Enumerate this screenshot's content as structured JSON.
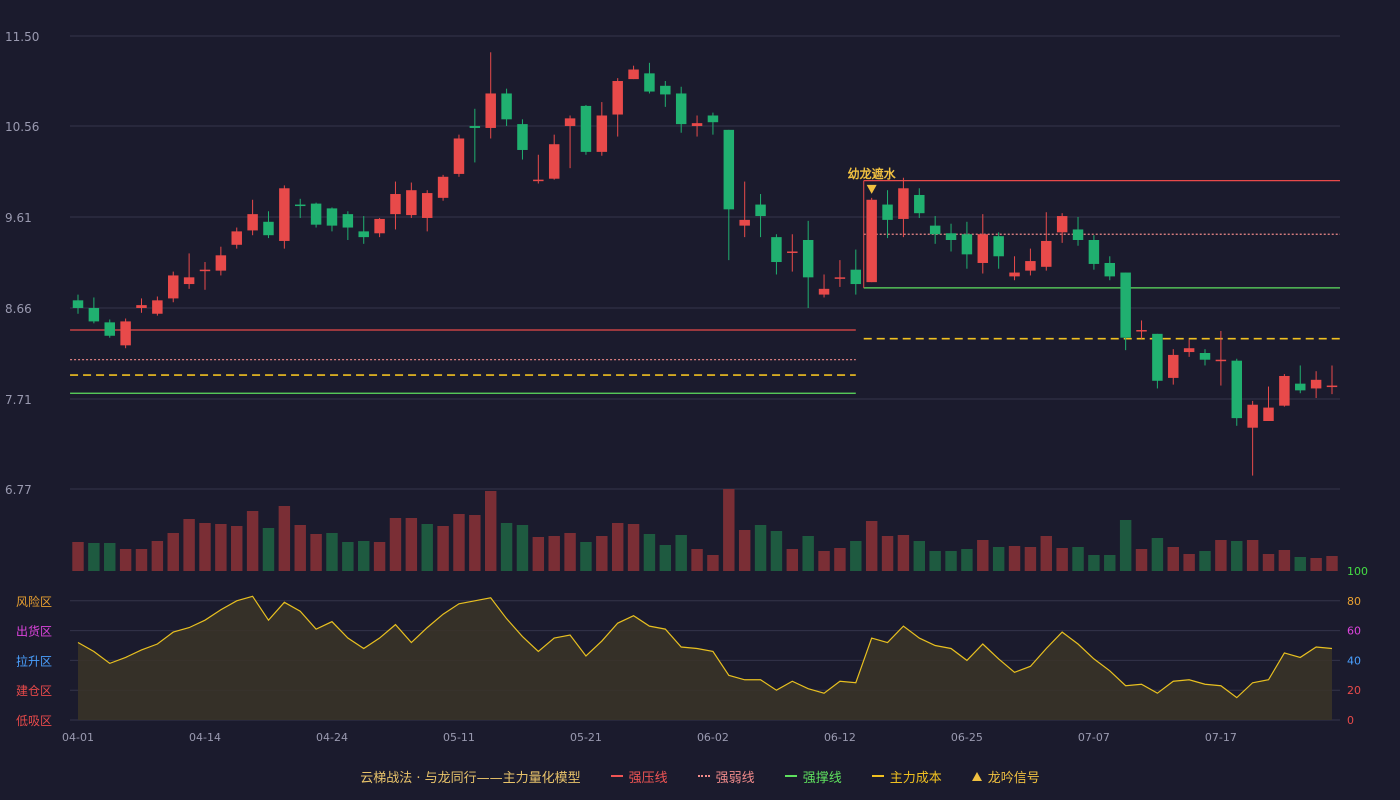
{
  "chart_data": {
    "type": "candlestick",
    "title": "",
    "price_axis": {
      "ticks": [
        11.5,
        10.56,
        9.61,
        8.66,
        7.71,
        6.77
      ],
      "ylim": [
        6.77,
        11.5
      ]
    },
    "x_ticks": [
      {
        "index": 0,
        "label": "04-01"
      },
      {
        "index": 8,
        "label": "04-14"
      },
      {
        "index": 16,
        "label": "04-24"
      },
      {
        "index": 24,
        "label": "05-11"
      },
      {
        "index": 32,
        "label": "05-21"
      },
      {
        "index": 40,
        "label": "06-02"
      },
      {
        "index": 48,
        "label": "06-12"
      },
      {
        "index": 56,
        "label": "06-25"
      },
      {
        "index": 64,
        "label": "07-07"
      },
      {
        "index": 72,
        "label": "07-17"
      }
    ],
    "candles": [
      [
        8.74,
        8.66,
        8.8,
        8.6
      ],
      [
        8.66,
        8.52,
        8.77,
        8.5
      ],
      [
        8.51,
        8.37,
        8.54,
        8.35
      ],
      [
        8.27,
        8.52,
        8.55,
        8.24
      ],
      [
        8.66,
        8.69,
        8.76,
        8.61
      ],
      [
        8.6,
        8.74,
        8.78,
        8.58
      ],
      [
        8.76,
        9.0,
        9.04,
        8.72
      ],
      [
        8.91,
        8.98,
        9.23,
        8.86
      ],
      [
        9.06,
        9.06,
        9.14,
        8.85
      ],
      [
        9.05,
        9.21,
        9.3,
        9.0
      ],
      [
        9.32,
        9.46,
        9.5,
        9.28
      ],
      [
        9.47,
        9.64,
        9.79,
        9.42
      ],
      [
        9.56,
        9.42,
        9.67,
        9.39
      ],
      [
        9.36,
        9.91,
        9.94,
        9.28
      ],
      [
        9.74,
        9.73,
        9.8,
        9.6
      ],
      [
        9.75,
        9.53,
        9.76,
        9.5
      ],
      [
        9.7,
        9.52,
        9.71,
        9.46
      ],
      [
        9.64,
        9.5,
        9.67,
        9.37
      ],
      [
        9.46,
        9.4,
        9.62,
        9.33
      ],
      [
        9.44,
        9.59,
        9.6,
        9.4
      ],
      [
        9.64,
        9.85,
        9.98,
        9.48
      ],
      [
        9.63,
        9.89,
        9.97,
        9.6
      ],
      [
        9.6,
        9.86,
        9.89,
        9.46
      ],
      [
        9.81,
        10.03,
        10.05,
        9.78
      ],
      [
        10.06,
        10.43,
        10.47,
        10.03
      ],
      [
        10.56,
        10.54,
        10.74,
        10.18
      ],
      [
        10.54,
        10.9,
        11.33,
        10.43
      ],
      [
        10.9,
        10.63,
        10.95,
        10.56
      ],
      [
        10.58,
        10.31,
        10.63,
        10.21
      ],
      [
        10.0,
        10.0,
        10.26,
        9.96
      ],
      [
        10.01,
        10.37,
        10.47,
        10.0
      ],
      [
        10.56,
        10.64,
        10.67,
        10.12
      ],
      [
        10.77,
        10.29,
        10.78,
        10.26
      ],
      [
        10.29,
        10.67,
        10.81,
        10.25
      ],
      [
        10.68,
        11.03,
        11.06,
        10.45
      ],
      [
        11.05,
        11.15,
        11.19,
        11.05
      ],
      [
        11.11,
        10.92,
        11.22,
        10.9
      ],
      [
        10.98,
        10.89,
        11.03,
        10.76
      ],
      [
        10.9,
        10.58,
        10.97,
        10.49
      ],
      [
        10.56,
        10.59,
        10.67,
        10.45
      ],
      [
        10.67,
        10.6,
        10.7,
        10.47
      ],
      [
        10.52,
        9.69,
        10.52,
        9.16
      ],
      [
        9.52,
        9.58,
        9.98,
        9.4
      ],
      [
        9.74,
        9.62,
        9.85,
        9.4
      ],
      [
        9.4,
        9.14,
        9.43,
        9.01
      ],
      [
        9.25,
        9.25,
        9.43,
        9.04
      ],
      [
        9.37,
        8.98,
        9.57,
        8.66
      ],
      [
        8.8,
        8.86,
        9.01,
        8.77
      ],
      [
        8.98,
        8.98,
        9.16,
        8.88
      ],
      [
        9.06,
        8.91,
        9.27,
        8.8
      ],
      [
        8.93,
        9.79,
        9.81,
        8.93
      ],
      [
        9.74,
        9.58,
        9.89,
        9.39
      ],
      [
        9.59,
        9.91,
        10.02,
        9.4
      ],
      [
        9.84,
        9.65,
        9.91,
        9.6
      ],
      [
        9.52,
        9.43,
        9.62,
        9.33
      ],
      [
        9.44,
        9.37,
        9.54,
        9.25
      ],
      [
        9.43,
        9.22,
        9.56,
        9.07
      ],
      [
        9.13,
        9.43,
        9.64,
        9.02
      ],
      [
        9.41,
        9.2,
        9.45,
        9.07
      ],
      [
        8.99,
        9.03,
        9.2,
        8.95
      ],
      [
        9.05,
        9.15,
        9.28,
        9.0
      ],
      [
        9.09,
        9.36,
        9.66,
        9.05
      ],
      [
        9.45,
        9.62,
        9.65,
        9.34
      ],
      [
        9.48,
        9.37,
        9.61,
        9.31
      ],
      [
        9.37,
        9.12,
        9.42,
        9.06
      ],
      [
        9.13,
        8.99,
        9.2,
        8.95
      ],
      [
        9.03,
        8.35,
        9.03,
        8.22
      ],
      [
        8.43,
        8.43,
        8.53,
        8.34
      ],
      [
        8.39,
        7.9,
        8.39,
        7.82
      ],
      [
        7.93,
        8.17,
        8.23,
        7.86
      ],
      [
        8.2,
        8.24,
        8.33,
        8.15
      ],
      [
        8.19,
        8.12,
        8.23,
        8.06
      ],
      [
        8.11,
        8.12,
        8.42,
        7.85
      ],
      [
        8.11,
        7.51,
        8.13,
        7.43
      ],
      [
        7.41,
        7.65,
        7.69,
        6.91
      ],
      [
        7.48,
        7.62,
        7.84,
        7.55
      ],
      [
        7.64,
        7.95,
        7.97,
        7.63
      ],
      [
        7.87,
        7.8,
        8.06,
        7.77
      ],
      [
        7.82,
        7.91,
        8.0,
        7.72
      ],
      [
        7.84,
        7.85,
        8.06,
        7.76
      ]
    ],
    "volume": [
      29,
      28,
      28,
      22,
      22,
      30,
      38,
      52,
      48,
      47,
      45,
      60,
      43,
      65,
      46,
      37,
      38,
      29,
      30,
      29,
      53,
      53,
      47,
      45,
      57,
      56,
      80,
      48,
      46,
      34,
      35,
      38,
      29,
      35,
      48,
      47,
      37,
      26,
      36,
      22,
      16,
      82,
      41,
      46,
      40,
      22,
      35,
      20,
      23,
      30,
      50,
      35,
      36,
      30,
      20,
      20,
      22,
      31,
      24,
      25,
      24,
      35,
      23,
      24,
      16,
      16,
      51,
      22,
      33,
      24,
      17,
      20,
      31,
      30,
      31,
      17,
      21,
      14,
      13,
      15
    ],
    "volume_up": [
      1,
      0,
      0,
      1,
      1,
      1,
      1,
      1,
      1,
      1,
      1,
      1,
      0,
      1,
      1,
      1,
      0,
      0,
      0,
      1,
      1,
      1,
      0,
      1,
      1,
      1,
      1,
      0,
      0,
      1,
      1,
      1,
      0,
      1,
      1,
      1,
      0,
      0,
      0,
      1,
      1,
      1,
      1,
      0,
      0,
      1,
      0,
      1,
      1,
      0,
      1,
      1,
      1,
      0,
      0,
      0,
      0,
      1,
      0,
      1,
      1,
      1,
      1,
      0,
      0,
      0,
      0,
      1,
      0,
      1,
      1,
      0,
      1,
      0,
      1,
      1,
      1,
      0,
      1,
      1
    ],
    "ind_axis": {
      "ticks": [
        0,
        20,
        40,
        60,
        80,
        100
      ],
      "ylim": [
        0,
        100
      ]
    },
    "zones": [
      "风险区",
      "出货区",
      "拉升区",
      "建仓区",
      "低吸区"
    ],
    "oscillator": [
      52,
      46,
      38,
      42,
      47,
      51,
      59,
      62,
      67,
      74,
      80,
      83,
      67,
      79,
      73,
      61,
      66,
      55,
      48,
      55,
      64,
      52,
      62,
      71,
      78,
      80,
      82,
      68,
      56,
      46,
      55,
      57,
      43,
      53,
      65,
      70,
      63,
      61,
      49,
      48,
      46,
      30,
      27,
      27,
      20,
      26,
      21,
      18,
      26,
      25,
      55,
      52,
      63,
      55,
      50,
      48,
      40,
      51,
      41,
      32,
      36,
      48,
      59,
      51,
      41,
      33,
      23,
      24,
      18,
      26,
      27,
      24,
      23,
      15,
      25,
      27,
      45,
      42,
      49,
      48
    ],
    "levels": [
      {
        "name": "强压线",
        "segments": [
          {
            "from": 0,
            "to": 49,
            "value": 8.43
          },
          {
            "from": 50,
            "to": 79,
            "value": 9.99
          }
        ]
      },
      {
        "name": "强弱线",
        "segments": [
          {
            "from": 0,
            "to": 49,
            "value": 8.12
          },
          {
            "from": 50,
            "to": 79,
            "value": 9.43
          }
        ]
      },
      {
        "name": "强撑线",
        "segments": [
          {
            "from": 0,
            "to": 49,
            "value": 7.77
          },
          {
            "from": 50,
            "to": 79,
            "value": 8.87
          }
        ]
      },
      {
        "name": "主力成本",
        "segments": [
          {
            "from": 0,
            "to": 49,
            "value": 7.96
          },
          {
            "from": 50,
            "to": 79,
            "value": 8.34
          }
        ]
      }
    ],
    "signal": {
      "label": "幼龙遮水",
      "index": 50
    },
    "colors": {
      "up": "#e84a4a",
      "down": "#20b070",
      "up_volume": "#7a2e35",
      "down_volume": "#1e5a40",
      "oscillator": "#e8c020",
      "background": "#1b1b2d"
    }
  },
  "legend": {
    "title": "云梯战法 · 与龙同行——主力量化模型",
    "items": [
      "强压线",
      "强弱线",
      "强撑线",
      "主力成本",
      "龙吟信号"
    ]
  }
}
